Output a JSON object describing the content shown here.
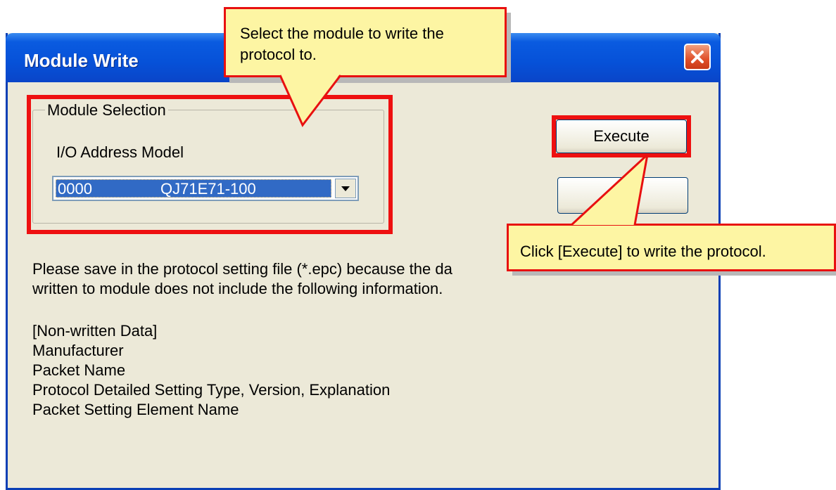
{
  "window": {
    "title": "Module Write"
  },
  "module_selection": {
    "group_label": "Module Selection",
    "field_label": "I/O Address Model",
    "selected_io": "0000",
    "selected_model": "QJ71E71-100"
  },
  "buttons": {
    "execute_label": "Execute",
    "second_label": ""
  },
  "notes": {
    "line1": "Please save in the protocol setting file (*.epc) because the da",
    "line2": "written to module does not include the following information.",
    "heading": "[Non-written Data]",
    "items": [
      "Manufacturer",
      "Packet Name",
      "Protocol Detailed Setting Type, Version, Explanation",
      "Packet Setting Element Name"
    ]
  },
  "callouts": {
    "top_line1": "Select the module to write the",
    "top_line2": "protocol to.",
    "right": "Click [Execute] to write the protocol."
  },
  "colors": {
    "highlight": "#ee1010",
    "callout_fill": "#fdf5a3",
    "titlebar": "#0651d8",
    "dialog_bg": "#ece9d8"
  }
}
